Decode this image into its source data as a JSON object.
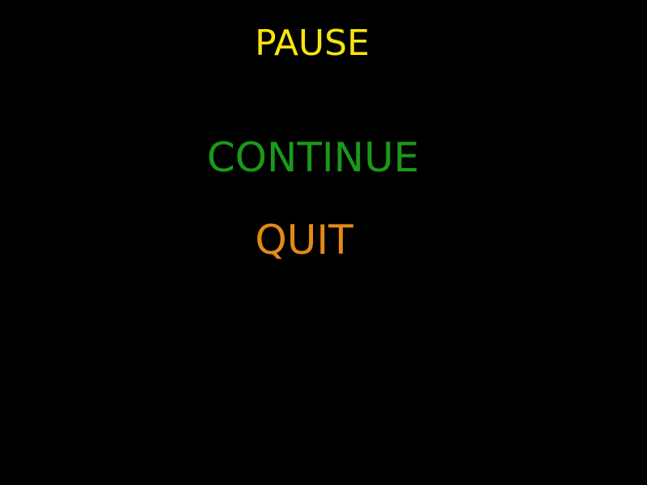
{
  "pause_menu": {
    "title": "PAUSE",
    "continue_label": "CONTINUE",
    "quit_label": "QUIT"
  },
  "colors": {
    "background": "#000000",
    "title": "#f7e40f",
    "continue": "#1a9a1a",
    "quit": "#e28a17"
  }
}
